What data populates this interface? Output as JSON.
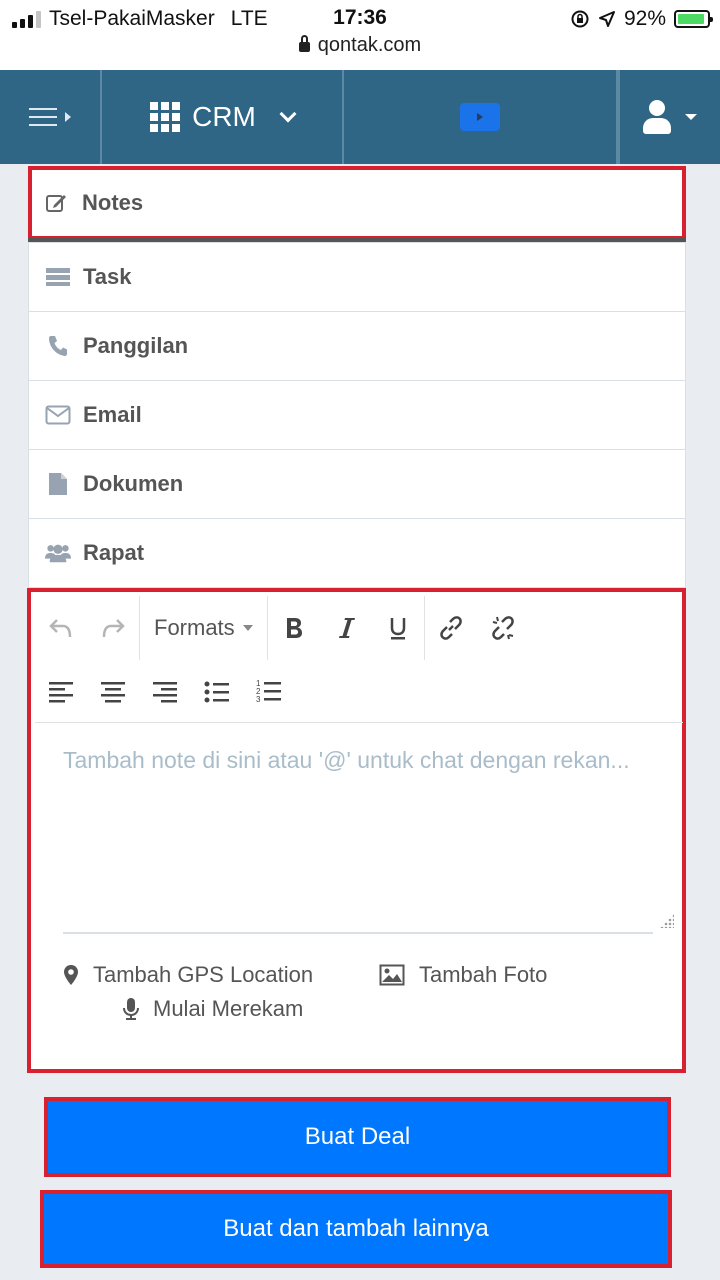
{
  "statusbar": {
    "carrier": "Tsel-PakaiMasker",
    "network": "LTE",
    "time": "17:36",
    "battery": "92%",
    "battery_level": 0.92,
    "url": "qontak.com"
  },
  "navbar": {
    "app_label": "CRM",
    "bg_color": "#2f6585"
  },
  "tabs": [
    {
      "label": "Notes",
      "icon": "edit-icon",
      "active": true
    },
    {
      "label": "Task",
      "icon": "task-list-icon"
    },
    {
      "label": "Panggilan",
      "icon": "phone-icon"
    },
    {
      "label": "Email",
      "icon": "envelope-icon"
    },
    {
      "label": "Dokumen",
      "icon": "document-icon"
    },
    {
      "label": "Rapat",
      "icon": "users-icon"
    }
  ],
  "editor": {
    "formats_label": "Formats",
    "placeholder": "Tambah note di sini atau '@' untuk chat dengan rekan...",
    "gps_label": "Tambah GPS Location",
    "photo_label": "Tambah Foto",
    "record_label": "Mulai Merekam"
  },
  "actions": {
    "create_deal": "Buat Deal",
    "create_and_add": "Buat dan tambah lainnya",
    "primary_color": "#0077ff"
  },
  "highlight_color": "#d72030"
}
